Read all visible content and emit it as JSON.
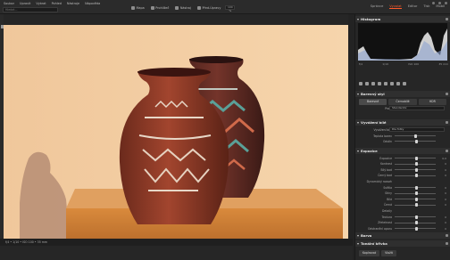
{
  "menu": [
    "Soubor",
    "Upravit",
    "Vybrat",
    "Pohled",
    "Nástroje",
    "Nápověda"
  ],
  "search_placeholder": "Hledat...",
  "toolbar": [
    {
      "label": "Mapa",
      "icon": "map-icon"
    },
    {
      "label": "Prohlížeč",
      "icon": "viewer-icon"
    },
    {
      "label": "Nástroj",
      "icon": "tool-icon"
    },
    {
      "label": "Před-Úpravy",
      "icon": "presets-icon"
    }
  ],
  "zoom": "100 %",
  "tabs": [
    {
      "label": "Správce",
      "active": false
    },
    {
      "label": "Vyvolat",
      "active": true
    },
    {
      "label": "Editor",
      "active": false
    },
    {
      "label": "Tisk",
      "active": false
    },
    {
      "label": "Mobil",
      "active": false
    }
  ],
  "status": "f/4 • 1/10 • ISO 100 • 35 mm",
  "panel": {
    "histogram": "Histogram",
    "histogram_info": [
      "f/4",
      "1/10",
      "ISO 100",
      "35 mm"
    ],
    "basic": "Barevný styl",
    "basic_tabs": [
      "Barevné",
      "Černobílé",
      "HDR"
    ],
    "profile_label": "Profil",
    "profile_value": "Standardní",
    "wb": "Vyvážení bílé",
    "wb_label": "Vyvážení bílé",
    "wb_value": "Dle fotky",
    "temp_label": "Teplota barev",
    "tint_label": "Odstín",
    "exposure": "Expozice",
    "sliders": [
      {
        "label": "Expozice",
        "value": "0,0",
        "pos": 0.5
      },
      {
        "label": "Kontrast",
        "value": "0",
        "pos": 0.5
      },
      {
        "label": "Bílý bod",
        "value": "0",
        "pos": 0.5
      },
      {
        "label": "Černý bod",
        "value": "0",
        "pos": 0.5
      },
      {
        "label": "Dynamický rozsah",
        "value": "",
        "pos": 0.5
      },
      {
        "label": "Světla",
        "value": "0",
        "pos": 0.5
      },
      {
        "label": "Stíny",
        "value": "0",
        "pos": 0.5
      },
      {
        "label": "Bílá",
        "value": "0",
        "pos": 0.5
      },
      {
        "label": "Černá",
        "value": "0",
        "pos": 0.5
      },
      {
        "label": "Detaily",
        "value": "",
        "pos": 0.5
      },
      {
        "label": "Textura",
        "value": "0",
        "pos": 0.5
      },
      {
        "label": "Zřetelnost",
        "value": "0",
        "pos": 0.5
      },
      {
        "label": "Odstranění oparu",
        "value": "0",
        "pos": 0.5
      }
    ],
    "color": "Barva",
    "tone_curve": "Tonální křivka",
    "footer_buttons": [
      "Kopírovat",
      "Vložit"
    ]
  }
}
